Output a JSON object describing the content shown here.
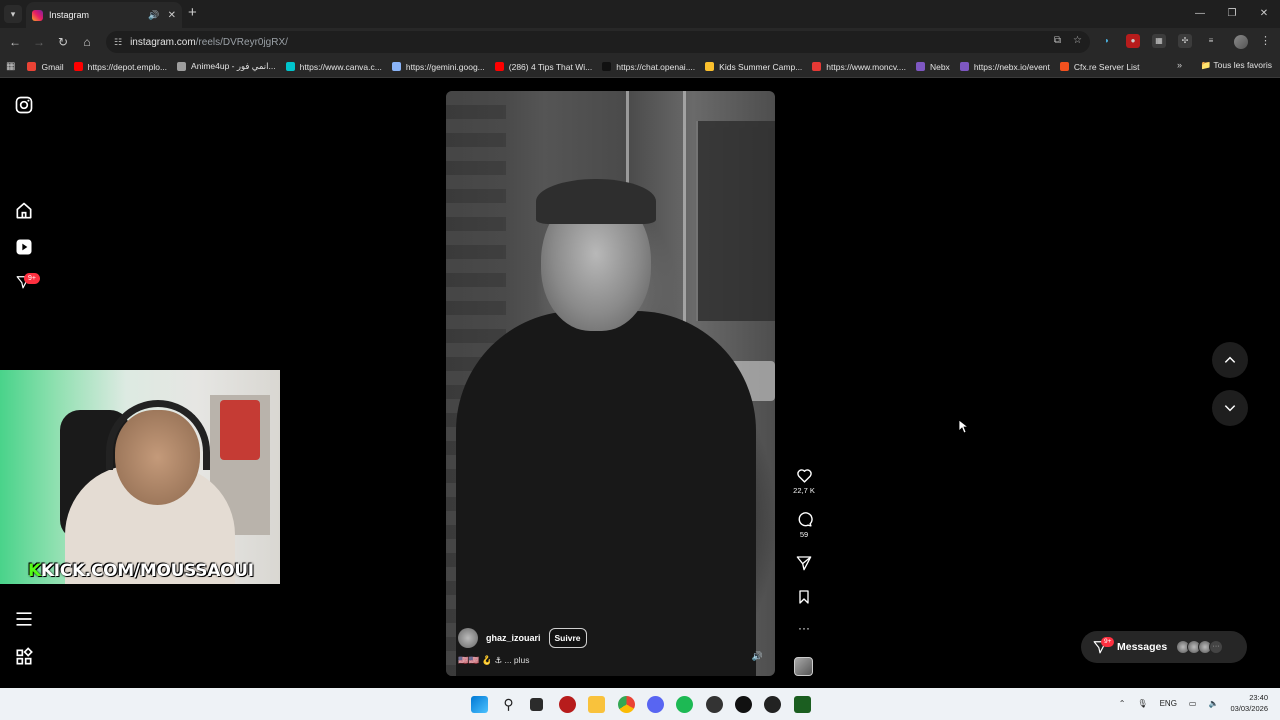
{
  "tabstrip": {
    "tab_title": "Instagram",
    "audio_icon": "speaker-icon",
    "close_glyph": "✕",
    "new_tab_glyph": "+",
    "window_controls": [
      "—",
      "❐",
      "✕"
    ]
  },
  "toolbar": {
    "url_host": "instagram.com",
    "url_path": "/reels/DVReyr0jgRX/"
  },
  "bookmarks": {
    "items": [
      {
        "label": "Gmail",
        "color": "#ea4335"
      },
      {
        "label": "https://depot.emplo...",
        "color": "#ff0000"
      },
      {
        "label": "Anime4up - انمي فور...",
        "color": "#9e9e9e"
      },
      {
        "label": "https://www.canva.c...",
        "color": "#00c4cc"
      },
      {
        "label": "https://gemini.goog...",
        "color": "#8ab4f8"
      },
      {
        "label": "(286) 4 Tips That Wi...",
        "color": "#ff0000"
      },
      {
        "label": "https://chat.openai....",
        "color": "#111111"
      },
      {
        "label": "Kids Summer Camp...",
        "color": "#fbc02d"
      },
      {
        "label": "https://www.moncv....",
        "color": "#e53935"
      },
      {
        "label": "Nebx",
        "color": "#7e57c2"
      },
      {
        "label": "https://nebx.io/event",
        "color": "#7e57c2"
      },
      {
        "label": "Cfx.re Server List",
        "color": "#f4511e"
      }
    ],
    "more_glyph": "»",
    "all_bookmarks": "Tous les favoris"
  },
  "sidebar": {
    "notification_badge": "9+"
  },
  "reel": {
    "username": "ghaz_izouari",
    "follow_label": "Suivre",
    "caption_emojis": "🇺🇸🇺🇸 🪝 ⚓",
    "caption_more": "... plus",
    "likes": "22,7 K",
    "comments": "59"
  },
  "messages": {
    "label": "Messages",
    "badge": "9+"
  },
  "webcam": {
    "overlay_prefix": "K",
    "overlay_text": "KICK.COM/MOUSSAOUI"
  },
  "taskbar": {
    "language": "ENG",
    "time": "23:40",
    "date": "03/03/2026"
  }
}
